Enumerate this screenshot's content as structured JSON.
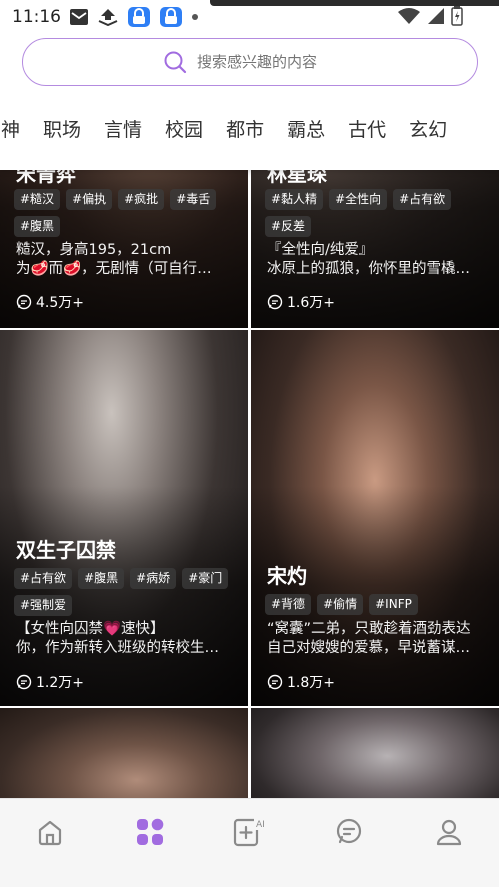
{
  "status_bar": {
    "time": "11:16",
    "icons": [
      "mail-icon",
      "download-icon",
      "lock-app-icon",
      "lock-app-icon",
      "dot-icon",
      "wifi-icon",
      "signal-icon",
      "battery-icon"
    ]
  },
  "search": {
    "placeholder": "搜索感兴趣的内容"
  },
  "tabs": [
    "女神",
    "职场",
    "言情",
    "校园",
    "都市",
    "霸总",
    "古代",
    "玄幻"
  ],
  "cards": [
    {
      "name": "宋青弈",
      "tags": [
        "#糙汉",
        "#偏执",
        "#疯批",
        "#毒舌",
        "#腹黑"
      ],
      "desc_line1": "糙汉，身高195，21cm",
      "desc_line2": "为🥩而🥩，无剧情（可自行…",
      "stat": "4.5万+"
    },
    {
      "name": "林星琛",
      "tags": [
        "#黏人精",
        "#全性向",
        "#占有欲",
        "#反差"
      ],
      "desc_line1": "『全性向/纯爱』",
      "desc_line2": "冰原上的孤狼，你怀里的雪橇…",
      "stat": "1.6万+"
    },
    {
      "name": "双生子囚禁",
      "tags": [
        "#占有欲",
        "#腹黑",
        "#病娇",
        "#豪门",
        "#强制爱"
      ],
      "desc_line1": "【女性向囚禁💗速快】",
      "desc_line2": "你，作为新转入班级的转校生…",
      "stat": "1.2万+"
    },
    {
      "name": "宋灼",
      "tags": [
        "#背德",
        "#偷情",
        "#INFP"
      ],
      "desc_line1": "“窝囊”二弟，只敢趁着酒劲表达",
      "desc_line2": "自己对嫂嫂的爱慕，早说蓄谋…",
      "stat": "1.8万+"
    }
  ],
  "bottom_nav": {
    "items": [
      "home-icon",
      "discover-icon",
      "create-ai-icon",
      "messages-icon",
      "profile-icon"
    ],
    "active_index": 1,
    "accent": "#a16ce0"
  },
  "colors": {
    "accent": "#a16ce0",
    "search_border": "#b48be0"
  }
}
